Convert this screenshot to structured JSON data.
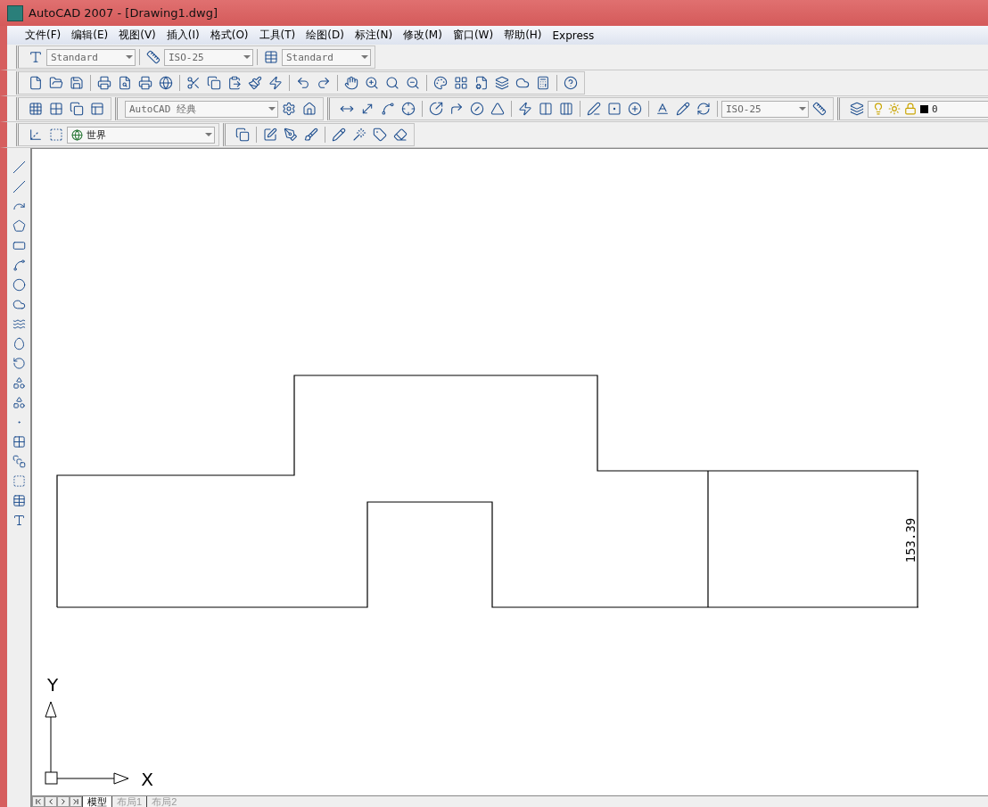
{
  "window": {
    "title": "AutoCAD 2007 - [Drawing1.dwg]"
  },
  "menu": [
    "文件(F)",
    "编辑(E)",
    "视图(V)",
    "插入(I)",
    "格式(O)",
    "工具(T)",
    "绘图(D)",
    "标注(N)",
    "修改(M)",
    "窗口(W)",
    "帮助(H)",
    "Express"
  ],
  "styles_toolbar": {
    "text_style": "Standard",
    "dim_style": "ISO-25",
    "table_style": "Standard"
  },
  "workspace": {
    "value": "AutoCAD 经典"
  },
  "dimension_toolbar": {
    "dim_style": "ISO-25"
  },
  "layer": {
    "name": "0"
  },
  "ucs": {
    "value": "世界"
  },
  "drawing": {
    "dimension": "153.39",
    "axis_x": "X",
    "axis_y": "Y"
  },
  "layout_tabs": [
    {
      "label": "模型",
      "selected": true
    },
    {
      "label": "布局1",
      "selected": false
    },
    {
      "label": "布局2",
      "selected": false
    }
  ]
}
